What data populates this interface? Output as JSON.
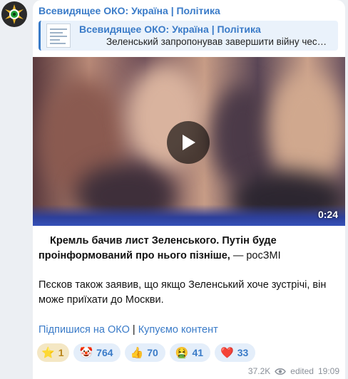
{
  "channel": {
    "name": "Всевидящее ОКО: Україна | Політика"
  },
  "reply": {
    "title": "Всевидящее ОКО: Україна | Політика",
    "text": "Зеленський запропонував завершити війну чес…"
  },
  "video": {
    "duration": "0:24"
  },
  "message": {
    "headline_bold": "Кремль бачив лист Зеленського. Путін буде проінформований про нього пізніше,",
    "headline_rest": " — росЗМІ",
    "body": "Пєсков також заявив, що якщо Зеленський хоче зустрічі, він може приїхати до Москви.",
    "link1": "Підпишися на ОКО",
    "separator": " | ",
    "link2": "Купуємо контент"
  },
  "reactions": [
    {
      "emoji": "⭐",
      "count": "1"
    },
    {
      "emoji": "🤡",
      "count": "764"
    },
    {
      "emoji": "👍",
      "count": "70"
    },
    {
      "emoji": "🤮",
      "count": "41"
    },
    {
      "emoji": "❤️",
      "count": "33"
    }
  ],
  "meta": {
    "views": "37.2K",
    "edited": "edited",
    "time": "19:09"
  }
}
